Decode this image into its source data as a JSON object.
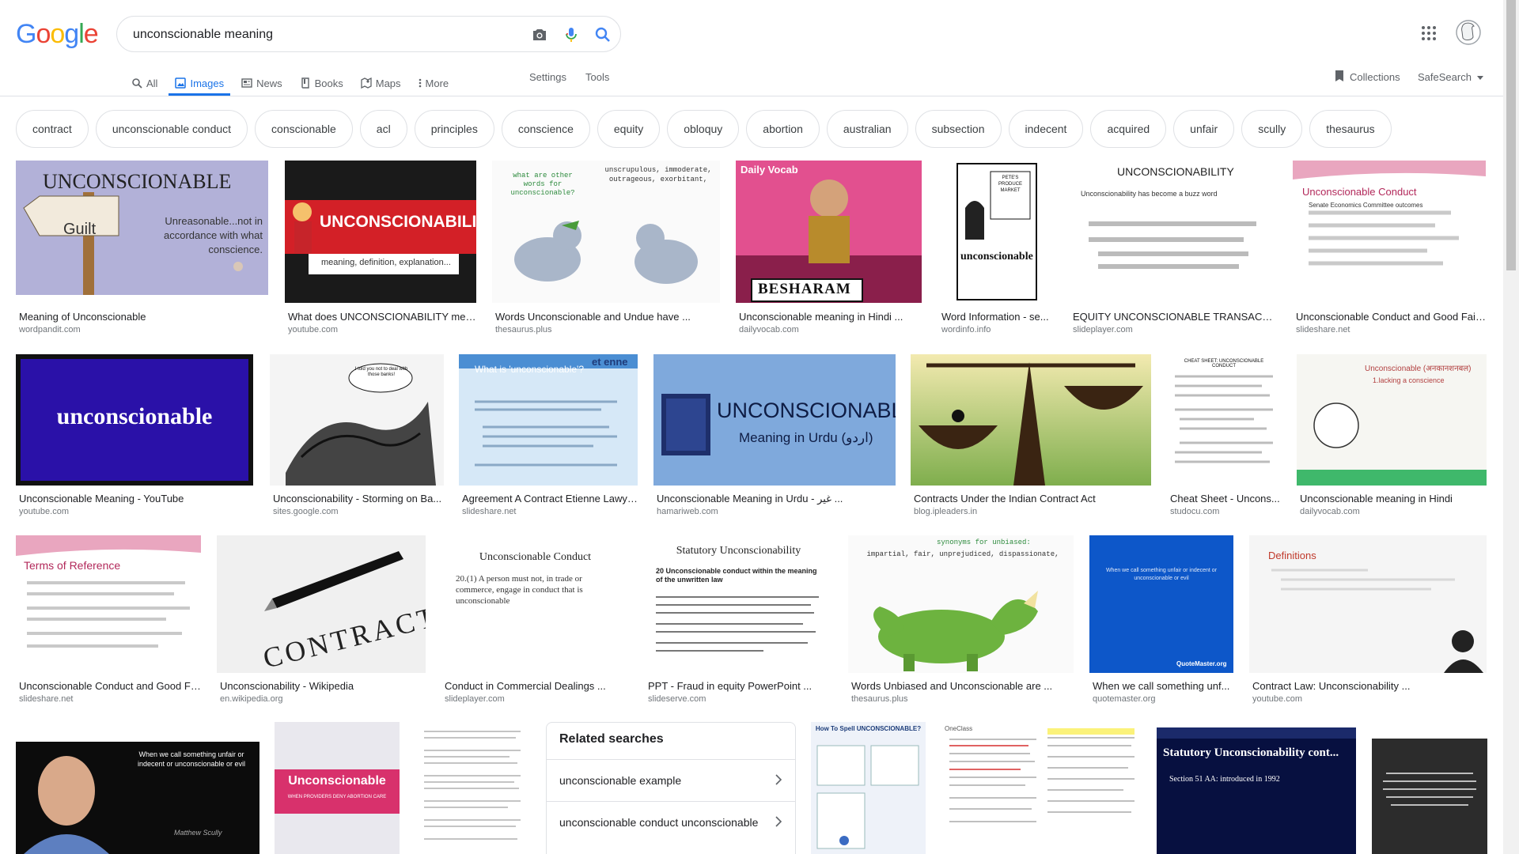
{
  "logo": {
    "letters": [
      "G",
      "o",
      "o",
      "g",
      "l",
      "e"
    ]
  },
  "search": {
    "value": "unconscionable meaning"
  },
  "nav": {
    "tabs": [
      {
        "label": "All",
        "icon": "search-icon"
      },
      {
        "label": "Images",
        "icon": "image-icon"
      },
      {
        "label": "News",
        "icon": "news-icon"
      },
      {
        "label": "Books",
        "icon": "book-icon"
      },
      {
        "label": "Maps",
        "icon": "map-icon"
      },
      {
        "label": "More",
        "icon": "more-vert-icon"
      }
    ],
    "settings": "Settings",
    "tools": "Tools",
    "collections": "Collections",
    "safesearch": "SafeSearch"
  },
  "chips": [
    "contract",
    "unconscionable conduct",
    "conscionable",
    "acl",
    "principles",
    "conscience",
    "equity",
    "obloquy",
    "abortion",
    "australian",
    "subsection",
    "indecent",
    "acquired",
    "unfair",
    "scully",
    "thesaurus"
  ],
  "row1": [
    {
      "caption": "Meaning of Unconscionable",
      "source": "wordpandit.com",
      "thumb_text": "UNCONSCIONABLE",
      "thumb_sub": "Unreasonable...not in accordance with what conscience."
    },
    {
      "caption": "What does UNCONSCIONABILITY mea...",
      "source": "youtube.com",
      "thumb_text": "UNCONSCIONABILITY",
      "thumb_sub": "meaning, definition, explanation..."
    },
    {
      "caption": "Words Unconscionable and Undue have ...",
      "source": "thesaurus.plus",
      "thumb_text": "unscrupulous, immoderate, outrageous, exorbitant,",
      "thumb_sub": "what are other words for unconscionable?"
    },
    {
      "caption": "Unconscionable meaning in Hindi ...",
      "source": "dailyvocab.com",
      "thumb_text": "BESHARAM",
      "thumb_sub": "Daily Vocab"
    },
    {
      "caption": "Word Information - se...",
      "source": "wordinfo.info",
      "thumb_text": "PETE'S PRODUCE MARKET",
      "thumb_sub": "unconscionable"
    },
    {
      "caption": "EQUITY UNCONSCIONABLE TRANSACTI...",
      "source": "slideplayer.com",
      "thumb_text": "UNCONSCIONABILITY",
      "thumb_sub": "Unconscionability has become a buzz word"
    },
    {
      "caption": "Unconscionable Conduct and Good Faith...",
      "source": "slideshare.net",
      "thumb_text": "Unconscionable Conduct",
      "thumb_sub": "Senate Economics Committee outcomes"
    }
  ],
  "row2": [
    {
      "caption": "Unconscionable Meaning - YouTube",
      "source": "youtube.com",
      "thumb_text": "unconscionable"
    },
    {
      "caption": "Unconscionability - Storming on Ba...",
      "source": "sites.google.com",
      "thumb_text": "I told you not to deal with those banks!"
    },
    {
      "caption": "Agreement A Contract Etienne Lawyers",
      "source": "slideshare.net",
      "thumb_text": "What is 'unconscionable'?",
      "thumb_sub": "et enne"
    },
    {
      "caption": "Unconscionable Meaning in Urdu - غیر ...",
      "source": "hamariweb.com",
      "thumb_text": "UNCONSCIONABLE",
      "thumb_sub": "Meaning in Urdu (اردو)"
    },
    {
      "caption": "Contracts Under the Indian Contract Act",
      "source": "blog.ipleaders.in"
    },
    {
      "caption": "Cheat Sheet - Uncons...",
      "source": "studocu.com",
      "thumb_text": "CHEAT SHEET: UNCONSCIONABLE CONDUCT"
    },
    {
      "caption": "Unconscionable meaning in Hindi",
      "source": "dailyvocab.com",
      "thumb_text": "Unconscionable (अनकानशनबल)",
      "thumb_sub": "1.lacking a conscience"
    }
  ],
  "row3": [
    {
      "caption": "Unconscionable Conduct and Good Fa...",
      "source": "slideshare.net",
      "thumb_text": "Terms of Reference"
    },
    {
      "caption": "Unconscionability - Wikipedia",
      "source": "en.wikipedia.org",
      "thumb_text": "CONTRACT"
    },
    {
      "caption": "Conduct in Commercial Dealings ...",
      "source": "slideplayer.com",
      "thumb_text": "Unconscionable Conduct",
      "thumb_sub": "20.(1) A person must not, in trade or commerce, engage in conduct that is unconscionable"
    },
    {
      "caption": "PPT - Fraud in equity PowerPoint ...",
      "source": "slideserve.com",
      "thumb_text": "Statutory Unconscionability",
      "thumb_sub": "20 Unconscionable conduct within the meaning of the unwritten law"
    },
    {
      "caption": "Words Unbiased and Unconscionable are ...",
      "source": "thesaurus.plus",
      "thumb_text": "synonyms for unbiased:",
      "thumb_sub": "impartial, fair, unprejudiced, dispassionate,"
    },
    {
      "caption": "When we call something unf...",
      "source": "quotemaster.org",
      "thumb_text": "When we call something unfair or indecent or unconscionable or evil"
    },
    {
      "caption": "Contract Law: Unconscionability ...",
      "source": "youtube.com",
      "thumb_text": "Definitions"
    }
  ],
  "row4": [
    {
      "thumb_text": "When we call something unfair or indecent or unconscionable or evil",
      "thumb_sub": "Matthew Scully"
    },
    {
      "thumb_text": "Unconscionable",
      "thumb_sub": "WHEN PROVIDERS DENY ABORTION CARE"
    },
    {
      "thumb_text": ""
    },
    {
      "thumb_text": "How To Spell UNCONSCIONABLE?"
    },
    {
      "thumb_text": "OneClass"
    },
    {
      "thumb_text": "Statutory Unconscionability cont...",
      "thumb_sub": "Section 51 AA: introduced in 1992"
    },
    {
      "thumb_text": ""
    }
  ],
  "related": {
    "title": "Related searches",
    "items": [
      "unconscionable example",
      "unconscionable conduct unconscionable"
    ]
  },
  "colors": {
    "accent": "#1a73e8",
    "blue": "#4285f4",
    "red": "#ea4335",
    "yellow": "#fbbc05",
    "green": "#34a853"
  }
}
